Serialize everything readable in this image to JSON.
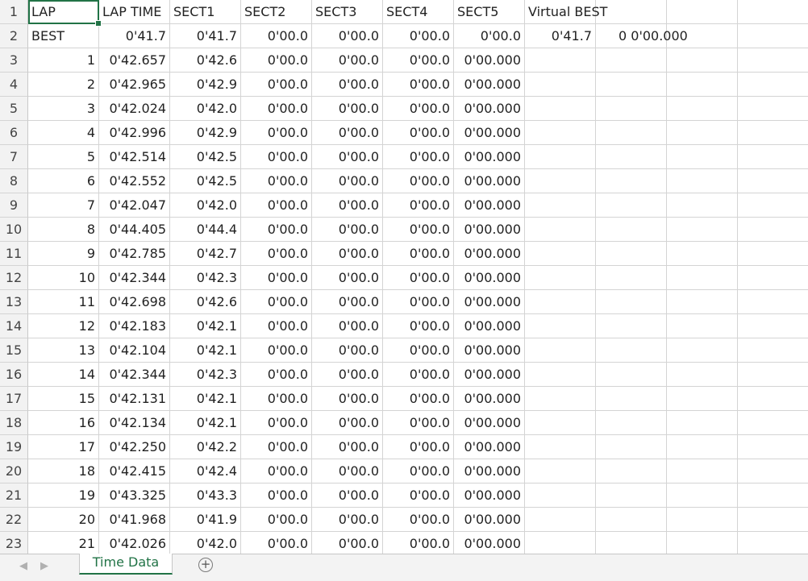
{
  "sheet": {
    "active_tab": "Time Data",
    "add_sheet_symbol": "+",
    "nav_prev_symbol": "◀",
    "nav_next_symbol": "▶"
  },
  "grid": {
    "row_numbers": [
      "1",
      "2",
      "3",
      "4",
      "5",
      "6",
      "7",
      "8",
      "9",
      "10",
      "11",
      "12",
      "13",
      "14",
      "15",
      "16",
      "17",
      "18",
      "19",
      "20",
      "21",
      "22",
      "23"
    ],
    "rows": [
      [
        "LAP",
        "LAP TIME",
        "SECT1",
        "SECT2",
        "SECT3",
        "SECT4",
        "SECT5",
        "Virtual BEST",
        "",
        "",
        ""
      ],
      [
        "BEST",
        "0'41.7",
        "0'41.7",
        "0'00.0",
        "0'00.0",
        "0'00.0",
        "0'00.0",
        "0'41.7",
        "0 0'00.000",
        "",
        ""
      ],
      [
        "1",
        "0'42.657",
        "0'42.6",
        "0'00.0",
        "0'00.0",
        "0'00.0",
        "0'00.000",
        "",
        "",
        "",
        ""
      ],
      [
        "2",
        "0'42.965",
        "0'42.9",
        "0'00.0",
        "0'00.0",
        "0'00.0",
        "0'00.000",
        "",
        "",
        "",
        ""
      ],
      [
        "3",
        "0'42.024",
        "0'42.0",
        "0'00.0",
        "0'00.0",
        "0'00.0",
        "0'00.000",
        "",
        "",
        "",
        ""
      ],
      [
        "4",
        "0'42.996",
        "0'42.9",
        "0'00.0",
        "0'00.0",
        "0'00.0",
        "0'00.000",
        "",
        "",
        "",
        ""
      ],
      [
        "5",
        "0'42.514",
        "0'42.5",
        "0'00.0",
        "0'00.0",
        "0'00.0",
        "0'00.000",
        "",
        "",
        "",
        ""
      ],
      [
        "6",
        "0'42.552",
        "0'42.5",
        "0'00.0",
        "0'00.0",
        "0'00.0",
        "0'00.000",
        "",
        "",
        "",
        ""
      ],
      [
        "7",
        "0'42.047",
        "0'42.0",
        "0'00.0",
        "0'00.0",
        "0'00.0",
        "0'00.000",
        "",
        "",
        "",
        ""
      ],
      [
        "8",
        "0'44.405",
        "0'44.4",
        "0'00.0",
        "0'00.0",
        "0'00.0",
        "0'00.000",
        "",
        "",
        "",
        ""
      ],
      [
        "9",
        "0'42.785",
        "0'42.7",
        "0'00.0",
        "0'00.0",
        "0'00.0",
        "0'00.000",
        "",
        "",
        "",
        ""
      ],
      [
        "10",
        "0'42.344",
        "0'42.3",
        "0'00.0",
        "0'00.0",
        "0'00.0",
        "0'00.000",
        "",
        "",
        "",
        ""
      ],
      [
        "11",
        "0'42.698",
        "0'42.6",
        "0'00.0",
        "0'00.0",
        "0'00.0",
        "0'00.000",
        "",
        "",
        "",
        ""
      ],
      [
        "12",
        "0'42.183",
        "0'42.1",
        "0'00.0",
        "0'00.0",
        "0'00.0",
        "0'00.000",
        "",
        "",
        "",
        ""
      ],
      [
        "13",
        "0'42.104",
        "0'42.1",
        "0'00.0",
        "0'00.0",
        "0'00.0",
        "0'00.000",
        "",
        "",
        "",
        ""
      ],
      [
        "14",
        "0'42.344",
        "0'42.3",
        "0'00.0",
        "0'00.0",
        "0'00.0",
        "0'00.000",
        "",
        "",
        "",
        ""
      ],
      [
        "15",
        "0'42.131",
        "0'42.1",
        "0'00.0",
        "0'00.0",
        "0'00.0",
        "0'00.000",
        "",
        "",
        "",
        ""
      ],
      [
        "16",
        "0'42.134",
        "0'42.1",
        "0'00.0",
        "0'00.0",
        "0'00.0",
        "0'00.000",
        "",
        "",
        "",
        ""
      ],
      [
        "17",
        "0'42.250",
        "0'42.2",
        "0'00.0",
        "0'00.0",
        "0'00.0",
        "0'00.000",
        "",
        "",
        "",
        ""
      ],
      [
        "18",
        "0'42.415",
        "0'42.4",
        "0'00.0",
        "0'00.0",
        "0'00.0",
        "0'00.000",
        "",
        "",
        "",
        ""
      ],
      [
        "19",
        "0'43.325",
        "0'43.3",
        "0'00.0",
        "0'00.0",
        "0'00.0",
        "0'00.000",
        "",
        "",
        "",
        ""
      ],
      [
        "20",
        "0'41.968",
        "0'41.9",
        "0'00.0",
        "0'00.0",
        "0'00.0",
        "0'00.000",
        "",
        "",
        "",
        ""
      ],
      [
        "21",
        "0'42.026",
        "0'42.0",
        "0'00.0",
        "0'00.0",
        "0'00.0",
        "0'00.000",
        "",
        "",
        "",
        ""
      ]
    ]
  },
  "colors": {
    "accent": "#217346",
    "gridline": "#d4d4d4",
    "header_bg": "#f2f2f2"
  }
}
